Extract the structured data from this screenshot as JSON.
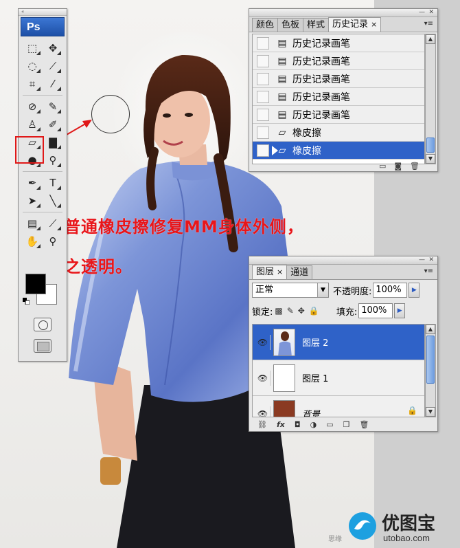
{
  "toolbox": {
    "logo": "Ps",
    "tools": [
      [
        "marquee-icon",
        "move-icon"
      ],
      [
        "lasso-icon",
        "magic-wand-icon"
      ],
      [
        "crop-icon",
        "slice-icon"
      ],
      [
        "healing-brush-icon",
        "brush-icon"
      ],
      [
        "clone-stamp-icon",
        "history-brush-icon"
      ],
      [
        "eraser-icon",
        "gradient-icon"
      ],
      [
        "blur-icon",
        "dodge-icon"
      ],
      [
        "pen-icon",
        "type-icon"
      ],
      [
        "path-select-icon",
        "line-icon"
      ],
      [
        "notes-icon",
        "eyedropper-icon"
      ],
      [
        "hand-icon",
        "zoom-icon"
      ]
    ],
    "foreground_color": "#000000",
    "background_color": "#ffffff"
  },
  "annotation": {
    "line1": "用普通橡皮擦修复MM身体外侧，",
    "line2": "使之透明。",
    "color": "#e8161a"
  },
  "history_panel": {
    "tabs": [
      {
        "label": "颜色",
        "active": false
      },
      {
        "label": "色板",
        "active": false
      },
      {
        "label": "样式",
        "active": false
      },
      {
        "label": "历史记录",
        "active": true
      }
    ],
    "close_glyph": "×",
    "items": [
      {
        "label": "历史记录画笔",
        "icon": "history-brush-step-icon",
        "selected": false
      },
      {
        "label": "历史记录画笔",
        "icon": "history-brush-step-icon",
        "selected": false
      },
      {
        "label": "历史记录画笔",
        "icon": "history-brush-step-icon",
        "selected": false
      },
      {
        "label": "历史记录画笔",
        "icon": "history-brush-step-icon",
        "selected": false
      },
      {
        "label": "历史记录画笔",
        "icon": "history-brush-step-icon",
        "selected": false
      },
      {
        "label": "橡皮擦",
        "icon": "eraser-step-icon",
        "selected": false
      },
      {
        "label": "橡皮擦",
        "icon": "eraser-step-icon",
        "selected": true
      }
    ]
  },
  "layers_panel": {
    "tabs": [
      {
        "label": "图层",
        "active": true
      },
      {
        "label": "通道",
        "active": false
      }
    ],
    "close_glyph": "×",
    "blend_mode": "正常",
    "opacity_label": "不透明度:",
    "opacity_value": "100%",
    "lock_label": "锁定:",
    "fill_label": "填充:",
    "fill_value": "100%",
    "layers": [
      {
        "name": "图层 2",
        "selected": true,
        "visible": true,
        "locked": false
      },
      {
        "name": "图层 1",
        "selected": false,
        "visible": true,
        "locked": false
      },
      {
        "name": "背景",
        "selected": false,
        "visible": true,
        "locked": true
      }
    ],
    "footer_icons": [
      "link-icon",
      "fx-icon",
      "mask-icon",
      "adjustment-icon",
      "group-icon",
      "new-layer-icon",
      "trash-icon"
    ],
    "fx_label": "fx"
  },
  "watermark": {
    "brand": "优图宝",
    "url": "utobao.com",
    "small": "思缘"
  }
}
